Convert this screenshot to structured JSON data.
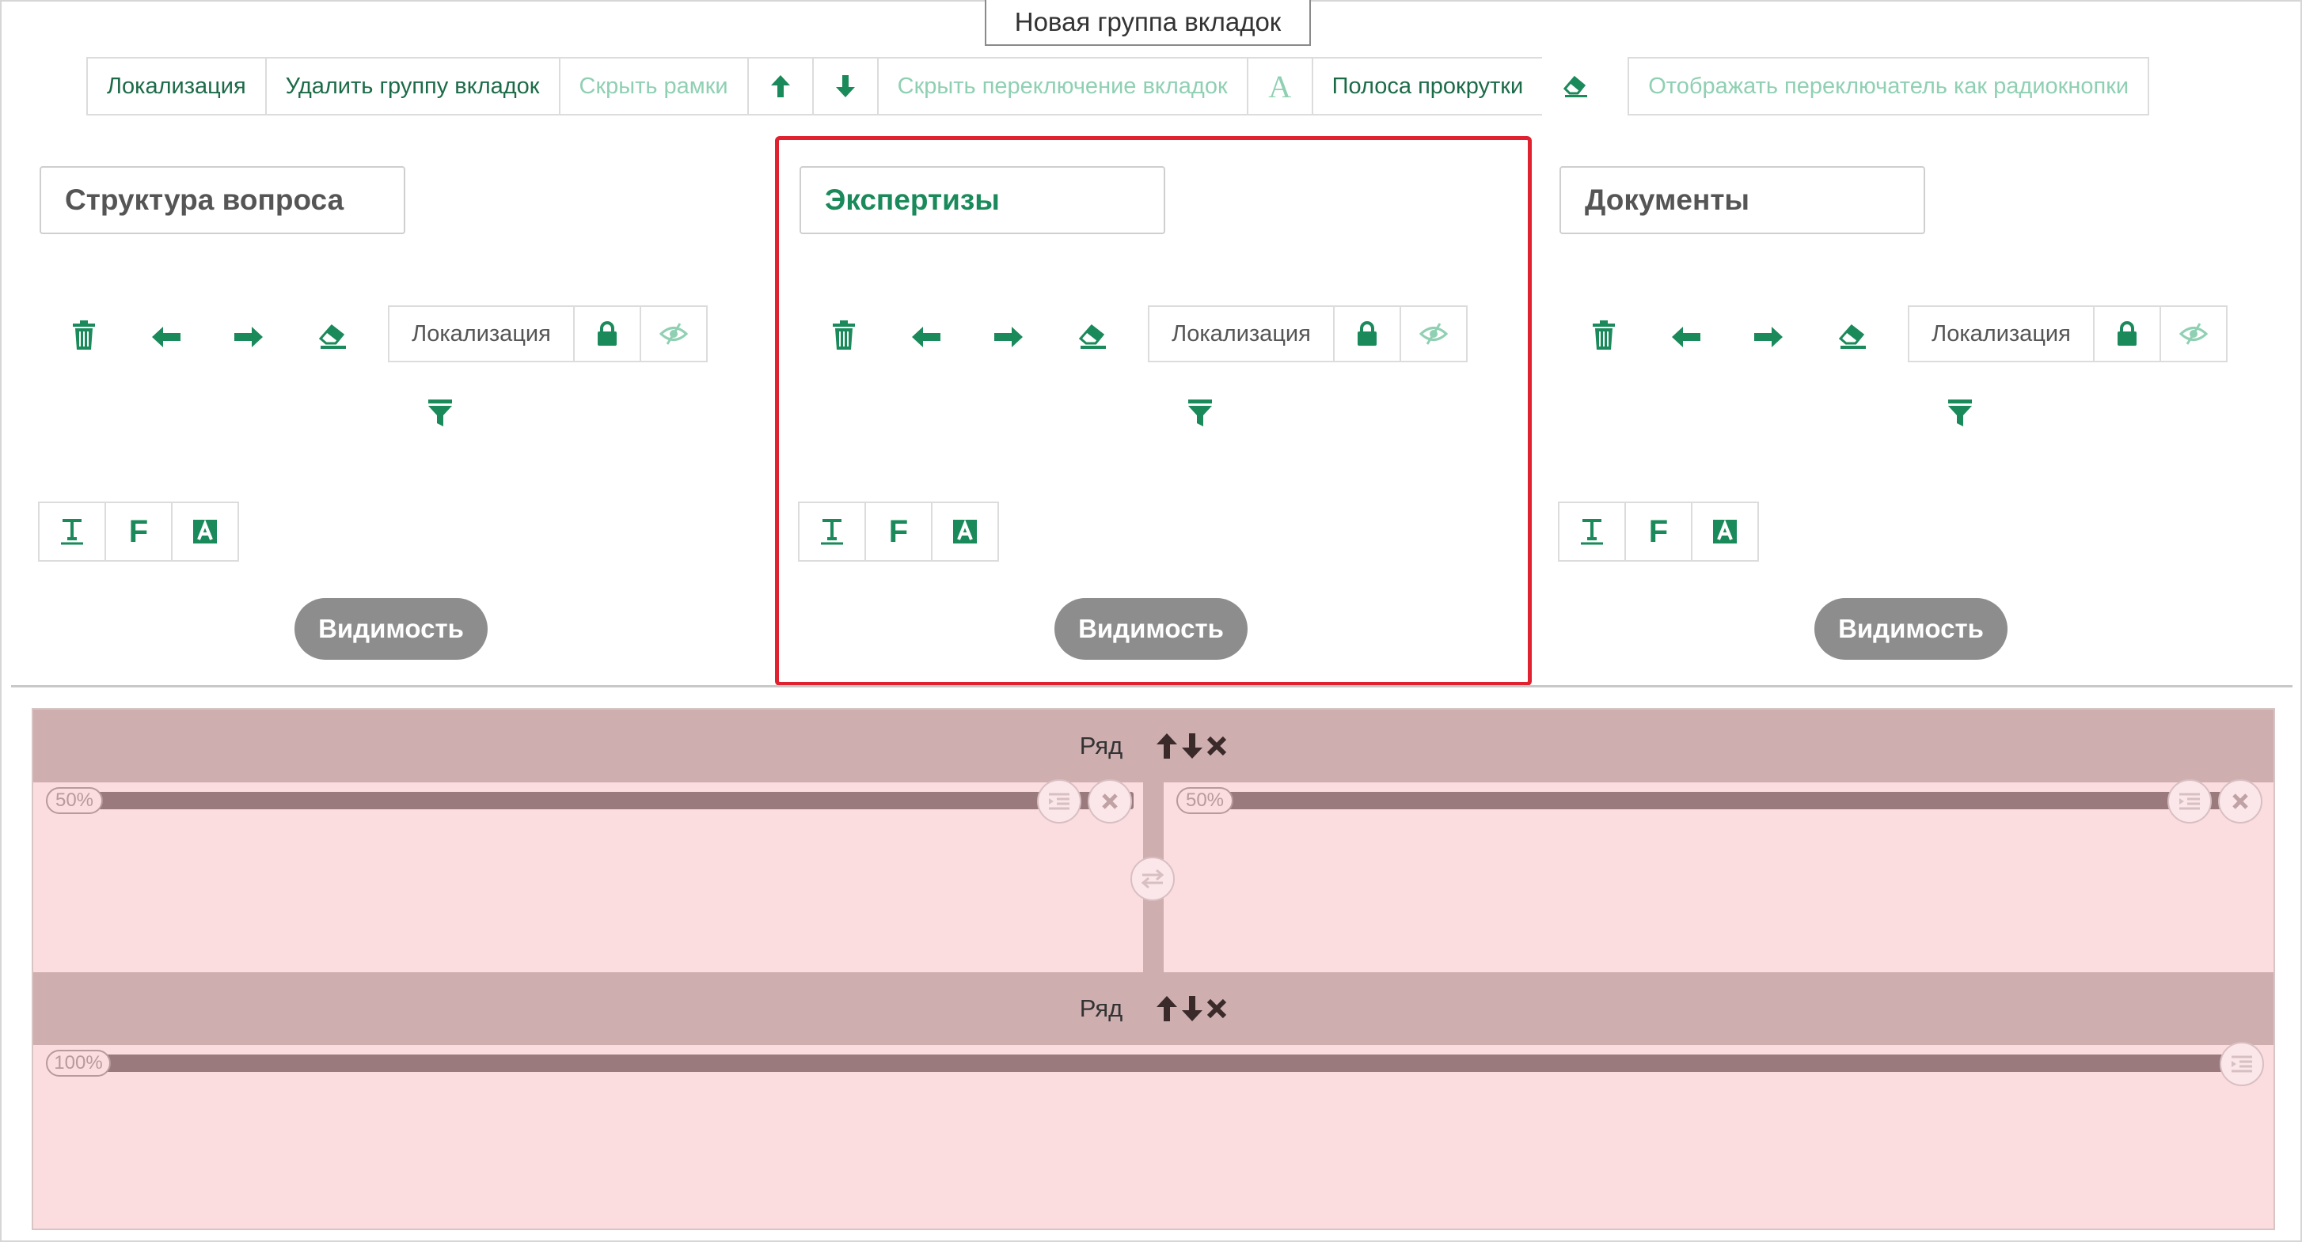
{
  "group": {
    "title": "Новая группа вкладок",
    "toolbar": {
      "localization": "Локализация",
      "delete_group": "Удалить группу вкладок",
      "hide_frames": "Скрыть рамки",
      "hide_switch": "Скрыть переключение вкладок",
      "font_glyph": "A",
      "scrollbar": "Полоса прокрутки",
      "radio_switch": "Отображать переключатель как радиокнопки"
    }
  },
  "tabs": [
    {
      "name": "Структура вопроса",
      "localization": "Локализация",
      "visibility": "Видимость",
      "fmt": [
        "T",
        "F",
        "A"
      ]
    },
    {
      "name": "Экспертизы",
      "localization": "Локализация",
      "visibility": "Видимость",
      "fmt": [
        "T",
        "F",
        "A"
      ]
    },
    {
      "name": "Документы",
      "localization": "Локализация",
      "visibility": "Видимость",
      "fmt": [
        "T",
        "F",
        "A"
      ]
    }
  ],
  "rows": [
    {
      "label": "Ряд",
      "columns": [
        {
          "width": "50%"
        },
        {
          "width": "50%"
        }
      ]
    },
    {
      "label": "Ряд",
      "columns": [
        {
          "width": "100%"
        }
      ]
    }
  ],
  "colors": {
    "accent": "#1a8a5a",
    "accent_light": "#8fd0b3",
    "active_border": "#e0212f",
    "row_bg": "#fbdcdf",
    "row_header": "#cfaeb0"
  }
}
